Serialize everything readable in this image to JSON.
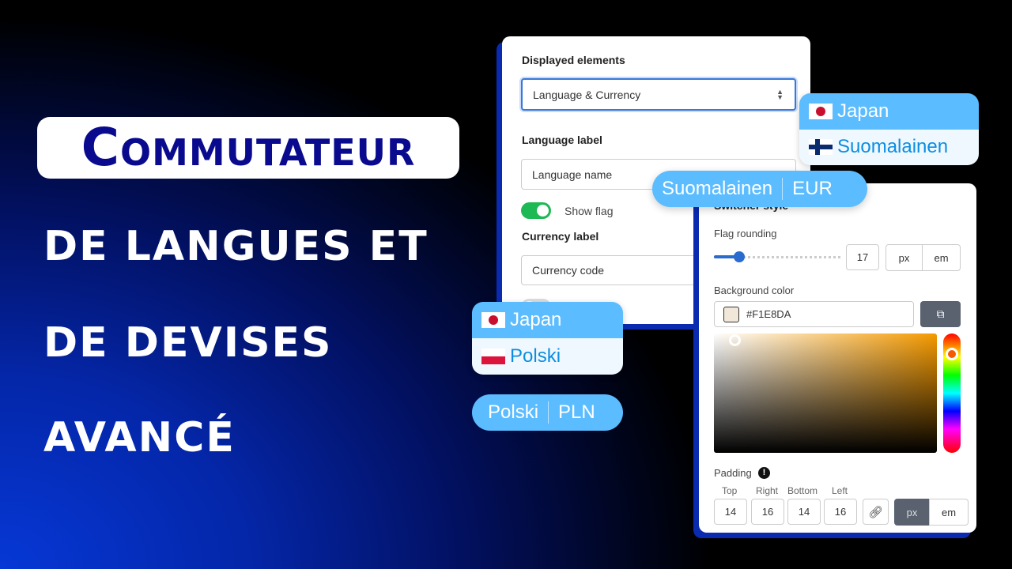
{
  "headline": {
    "line1": "Commutateur",
    "line2": "DE LANGUES ET",
    "line3": "DE DEVISES",
    "line4": "AVANCÉ"
  },
  "settings": {
    "displayed_elements_label": "Displayed elements",
    "displayed_elements_value": "Language & Currency",
    "language_label": "Language label",
    "language_value": "Language name",
    "show_flag_label": "Show flag",
    "show_flag_on": true,
    "currency_label": "Currency label",
    "currency_value": "Currency code"
  },
  "style": {
    "title": "Switcher style",
    "flag_rounding_label": "Flag rounding",
    "flag_rounding_value": "17",
    "flag_rounding_fraction": 0.17,
    "units": [
      "px",
      "em"
    ],
    "bg_color_label": "Background color",
    "bg_color_value": "#F1E8DA",
    "padding_label": "Padding",
    "padding": [
      {
        "label": "Top",
        "value": "14"
      },
      {
        "label": "Right",
        "value": "16"
      },
      {
        "label": "Bottom",
        "value": "14"
      },
      {
        "label": "Left",
        "value": "16"
      }
    ],
    "padding_unit_selected": "px"
  },
  "previews": {
    "dropdown1": {
      "current": "Japan",
      "option": "Suomalainen"
    },
    "pill1": {
      "language": "Suomalainen",
      "currency": "EUR"
    },
    "dropdown2": {
      "current": "Japan",
      "option": "Polski"
    },
    "pill2": {
      "language": "Polski",
      "currency": "PLN"
    }
  },
  "colors": {
    "accent": "#5bbcff",
    "navy": "#0a0a8e",
    "toggle": "#1db954",
    "panel_shadow": "#0a2bb0"
  }
}
